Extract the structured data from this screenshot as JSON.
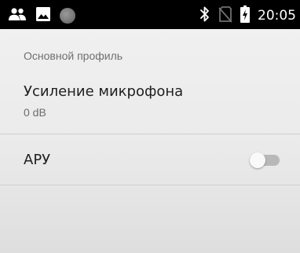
{
  "status_bar": {
    "time": "20:05",
    "left_icons": [
      "people-icon",
      "image-icon",
      "circle-icon"
    ],
    "right_icons": [
      "bluetooth-icon",
      "no-sim-icon",
      "battery-charging-icon"
    ]
  },
  "settings": {
    "section_header": "Основной профиль",
    "mic_gain": {
      "title": "Усиление микрофона",
      "summary": "0 dB"
    },
    "agc": {
      "label": "АРУ",
      "enabled": false
    }
  },
  "colors": {
    "status_bar_bg": "#000000",
    "background": "#ebebeb",
    "divider": "#cfcfcf",
    "switch_off_track": "#b8b8b8"
  }
}
